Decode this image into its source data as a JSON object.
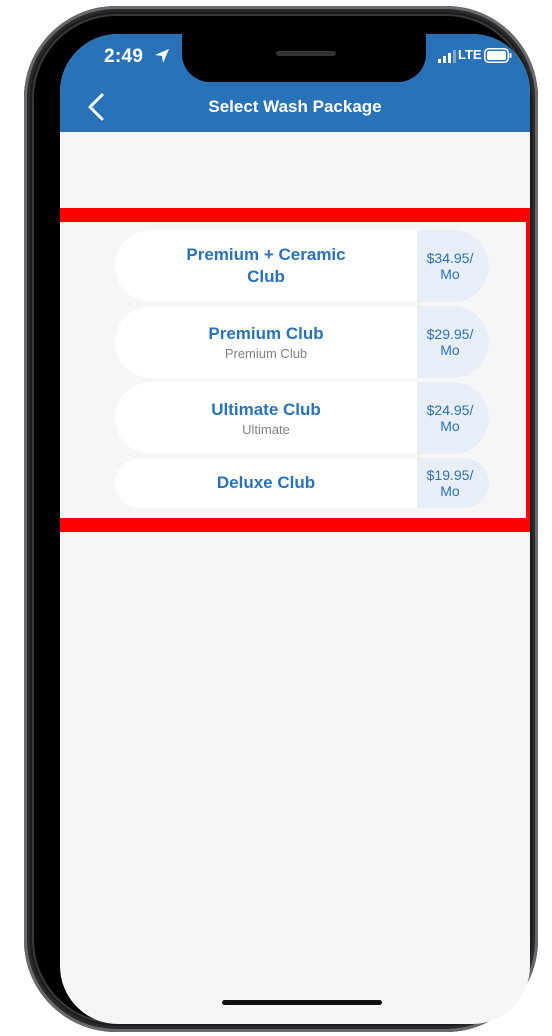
{
  "status_bar": {
    "time": "2:49",
    "network": "LTE"
  },
  "header": {
    "title": "Select Wash Package"
  },
  "packages": [
    {
      "name": "Premium + Ceramic Club",
      "subtitle": "",
      "price": "$34.95/ Mo"
    },
    {
      "name": "Premium Club",
      "subtitle": "Premium Club",
      "price": "$29.95/ Mo"
    },
    {
      "name": "Ultimate Club",
      "subtitle": "Ultimate",
      "price": "$24.95/ Mo"
    },
    {
      "name": "Deluxe Club",
      "subtitle": "",
      "price": "$19.95/ Mo"
    }
  ],
  "colors": {
    "header_bg": "#2a72b8",
    "accent_text": "#2a72b8",
    "price_bg": "#e7eef7",
    "highlight": "#ff0000",
    "screen_bg": "#f7f6f7"
  },
  "icons": {
    "back": "chevron-left-icon",
    "location": "location-arrow-icon",
    "signal": "signal-bars-icon",
    "battery": "battery-icon"
  }
}
